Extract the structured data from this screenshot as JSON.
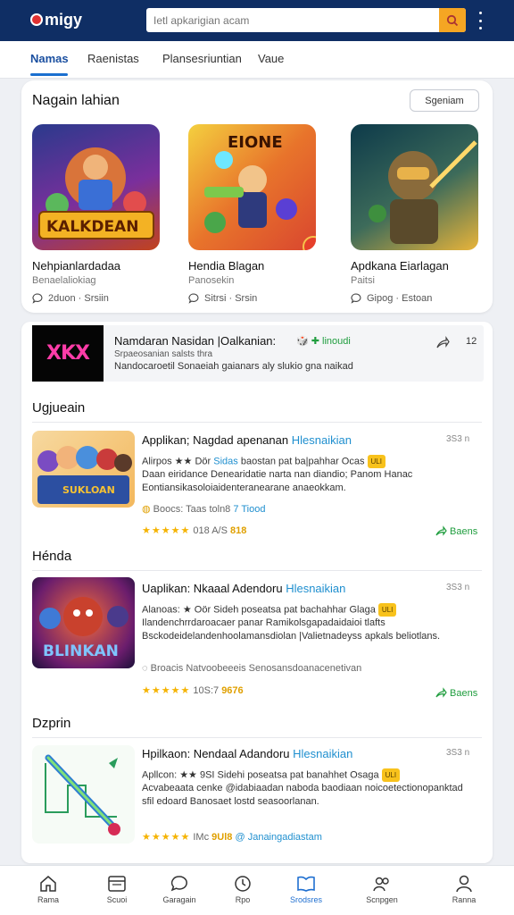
{
  "app": {
    "logo_text": "migy"
  },
  "search": {
    "placeholder": "Ietl apkarigian acam"
  },
  "tabs": [
    {
      "label": "Namas"
    },
    {
      "label": "Raenistas"
    },
    {
      "label": "Plansesriuntian"
    },
    {
      "label": "Vaue"
    }
  ],
  "featured": {
    "title": "Nagain lahian",
    "button_label": "Sgeniam",
    "items": [
      {
        "image_text": "KALKDEAN",
        "name": "Nehpianlardadaa",
        "sub": "Benaelaliokiag",
        "meta": "2duon · Srsiin"
      },
      {
        "image_text": "EIONE",
        "name": "Hendia Blagan",
        "sub": "Panosekin",
        "meta": "Sitrsi · Srsin"
      },
      {
        "image_text": "",
        "name": "Apdkana Eiarlagan",
        "sub": "Paitsi",
        "meta": "Gipog · Estoan"
      }
    ]
  },
  "banner": {
    "logo_text": "XKX",
    "title": "Namdaran Nasidan |Oalkanian:",
    "tag": "🎲 ✚ linoudi",
    "count": "12",
    "line1": "Srpaeosanian salsts thra",
    "line2": "Nandocaroetil Sonaeiah gaianars aly slukio gna naikad"
  },
  "lists": [
    {
      "heading": "Ugjueain",
      "image_text": "SUKLOAN",
      "title_prefix": "Applikan; Nagdad",
      "title_mid": "apenanan",
      "title_hl": "Hlesnaikian",
      "date": "3S3 n",
      "desc_1": "Alirpos ★★ Dör",
      "desc_hl": "Sidas",
      "desc_2": "baostan pat ba|pahhar Ocas",
      "desc_tag": "ULI",
      "desc_3": "Daan eiridance Denearidatie narta nan diandio; Panom Hanac Eontiansikasoloiaidenteranearane anaeokkam.",
      "meta_1": "Boocs: Taas toln8",
      "meta_hl": "7 Tiood",
      "rating_stars": "★★★★★",
      "rating_text": "018",
      "rating_extra": "A/S",
      "rating_y": "818",
      "share_label": "Baens"
    },
    {
      "heading": "Hénda",
      "image_text": "BLINKAN",
      "title_prefix": "Uaplikan: Nkaaal Adendoru",
      "title_mid": "",
      "title_hl": "Hlesnaikian",
      "date": "3S3 n",
      "desc_1": "Alanoas: ★ Oör Sideh",
      "desc_hl": "",
      "desc_2": "poseatsa pat bachahhar Glaga",
      "desc_tag": "ULI",
      "desc_3": "Ilandenchrrdaroacaer panar Ramikolsgapadaidaioi tlafts Bsckodeidelandenhoolamansdiolan |Valietnadeyss apkals beliotlans.",
      "meta_1": "Broacis Natvoobeeeis Senosansdoanacenetivan",
      "meta_hl": "",
      "rating_stars": "★★★★★",
      "rating_text": "10S:7",
      "rating_extra": "",
      "rating_y": "9676",
      "share_label": "Baens"
    },
    {
      "heading": "Dzprin",
      "image_text": "",
      "title_prefix": "Hpilkaon: Nendaal Adandoru",
      "title_mid": "",
      "title_hl": "Hlesnaikian",
      "date": "3S3 n",
      "desc_1": "Apllcon: ★★ 9SI Sidehi",
      "desc_hl": "",
      "desc_2": "poseatsa pat banahhet Osaga",
      "desc_tag": "ULI",
      "desc_3": "Acvabeaata cenke @idabiaadan naboda baodiaan noicoetectionopanktad sfil edoard Banosaet lostd seasoorlanan.",
      "meta_1": "",
      "meta_hl": "",
      "rating_stars": "★★★★★",
      "rating_text": "IMc",
      "rating_extra": "",
      "rating_y": "9Ul8",
      "rating_hl": "@ Janaingadiastam",
      "share_label": ""
    }
  ],
  "bottom_nav": [
    {
      "label": "Rama",
      "icon": "home-icon"
    },
    {
      "label": "Scuoi",
      "icon": "window-icon"
    },
    {
      "label": "Garagain",
      "icon": "chat-icon"
    },
    {
      "label": "Rpo",
      "icon": "clock-icon"
    },
    {
      "label": "Srodsres",
      "icon": "book-icon"
    },
    {
      "label": "Scnpgen",
      "icon": "group-icon"
    },
    {
      "label": "Ranna",
      "icon": "user-icon"
    }
  ],
  "colors": {
    "header": "#0f2e64",
    "accent": "#1a6fd0",
    "search_button": "#f5a623",
    "share_green": "#1f9d3e"
  }
}
